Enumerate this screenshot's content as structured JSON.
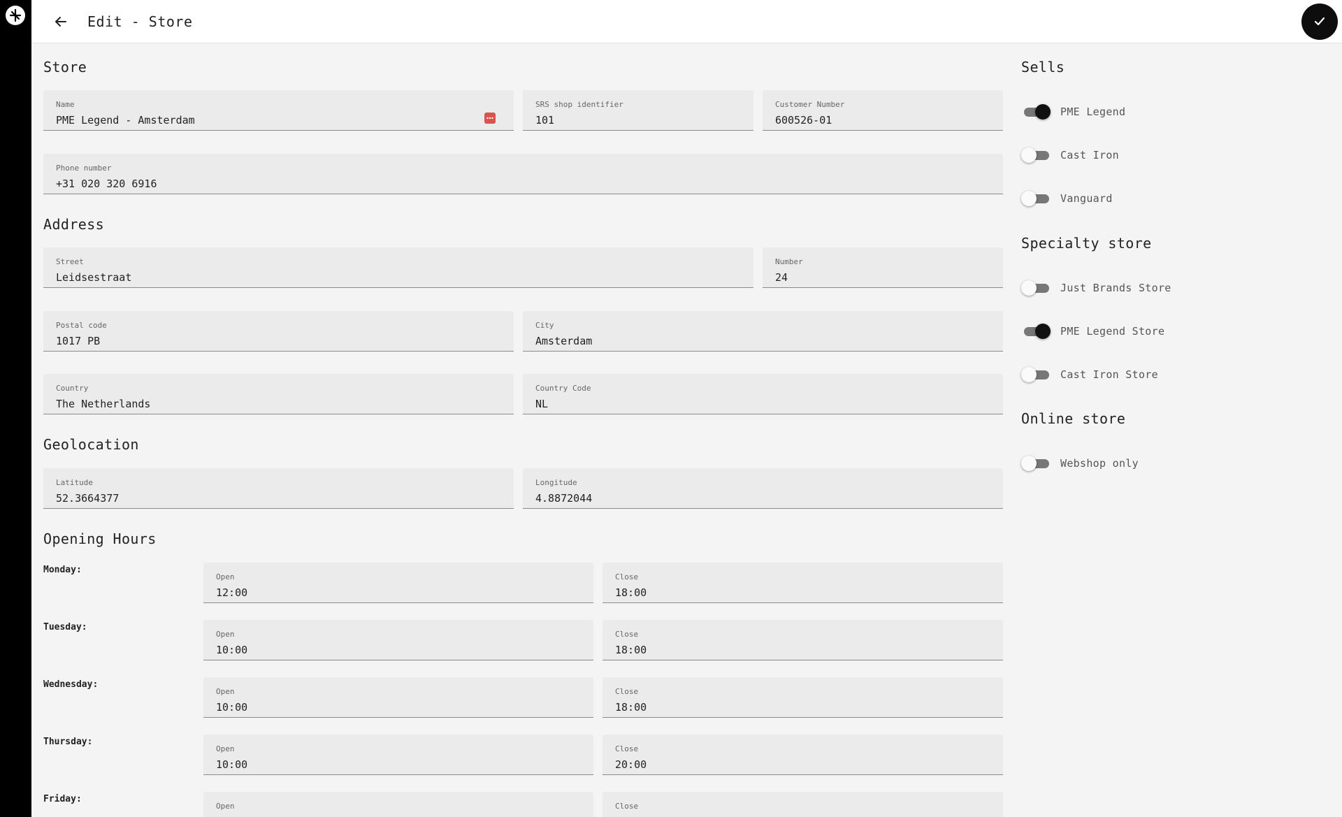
{
  "header": {
    "title": "Edit - Store"
  },
  "store": {
    "title": "Store",
    "name": {
      "label": "Name",
      "value": "PME Legend - Amsterdam"
    },
    "srs": {
      "label": "SRS shop identifier",
      "value": "101"
    },
    "customer": {
      "label": "Customer Number",
      "value": "600526-01"
    },
    "phone": {
      "label": "Phone number",
      "value": "+31 020 320 6916"
    }
  },
  "address": {
    "title": "Address",
    "street": {
      "label": "Street",
      "value": "Leidsestraat"
    },
    "number": {
      "label": "Number",
      "value": "24"
    },
    "postal": {
      "label": "Postal code",
      "value": "1017 PB"
    },
    "city": {
      "label": "City",
      "value": "Amsterdam"
    },
    "country": {
      "label": "Country",
      "value": "The Netherlands"
    },
    "country_code": {
      "label": "Country Code",
      "value": "NL"
    }
  },
  "geo": {
    "title": "Geolocation",
    "lat": {
      "label": "Latitude",
      "value": "52.3664377"
    },
    "lng": {
      "label": "Longitude",
      "value": "4.8872044"
    }
  },
  "hours": {
    "title": "Opening Hours",
    "open_label": "Open",
    "close_label": "Close",
    "days": [
      {
        "day": "Monday:",
        "open": "12:00",
        "close": "18:00"
      },
      {
        "day": "Tuesday:",
        "open": "10:00",
        "close": "18:00"
      },
      {
        "day": "Wednesday:",
        "open": "10:00",
        "close": "18:00"
      },
      {
        "day": "Thursday:",
        "open": "10:00",
        "close": "20:00"
      },
      {
        "day": "Friday:",
        "open": "",
        "close": ""
      }
    ]
  },
  "sells": {
    "title": "Sells",
    "items": [
      {
        "label": "PME Legend",
        "on": true
      },
      {
        "label": "Cast Iron",
        "on": false
      },
      {
        "label": "Vanguard",
        "on": false
      }
    ]
  },
  "specialty": {
    "title": "Specialty store",
    "items": [
      {
        "label": "Just Brands Store",
        "on": false
      },
      {
        "label": "PME Legend Store",
        "on": true
      },
      {
        "label": "Cast Iron Store",
        "on": false
      }
    ]
  },
  "online": {
    "title": "Online store",
    "items": [
      {
        "label": "Webshop only",
        "on": false
      }
    ]
  },
  "colors": {
    "accent": "#0d0d0d",
    "field_bg": "#ebebeb",
    "page_bg": "#f4f4f4",
    "warning_icon": "#d9534f"
  }
}
